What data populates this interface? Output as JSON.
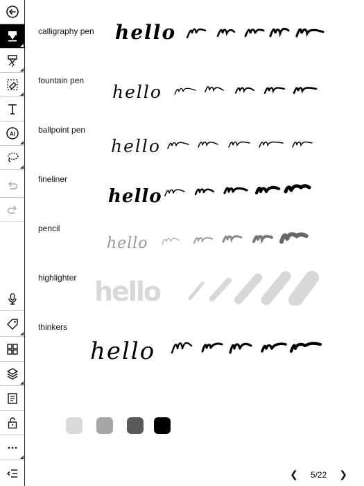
{
  "toolbar": {
    "items": [
      {
        "name": "back-icon"
      },
      {
        "name": "calligraphy-pen-tool-icon",
        "active": true
      },
      {
        "name": "eraser-pen-icon"
      },
      {
        "name": "eraser-icon"
      },
      {
        "name": "text-tool-icon",
        "glyph": "T"
      },
      {
        "name": "ai-tool-icon",
        "glyph": "AI"
      },
      {
        "name": "lasso-icon"
      },
      {
        "name": "undo-icon"
      },
      {
        "name": "redo-icon"
      },
      {
        "name": "microphone-icon"
      },
      {
        "name": "tag-icon"
      },
      {
        "name": "grid-icon"
      },
      {
        "name": "layers-icon"
      },
      {
        "name": "document-icon"
      },
      {
        "name": "lock-icon"
      },
      {
        "name": "more-icon",
        "glyph": "···"
      },
      {
        "name": "collapse-menu-icon"
      }
    ]
  },
  "pens": [
    {
      "label": "calligraphy pen"
    },
    {
      "label": "fountain pen"
    },
    {
      "label": "ballpoint pen"
    },
    {
      "label": "fineliner"
    },
    {
      "label": "pencil"
    },
    {
      "label": "highlighter"
    },
    {
      "label": "thinkers"
    }
  ],
  "sample_word": "hello",
  "colors": {
    "swatches": [
      "#d9d9d9",
      "#a6a6a6",
      "#595959",
      "#000000"
    ],
    "ink": "#000000",
    "highlighter": "#d8d8d8",
    "pencil": "#888888"
  },
  "pager": {
    "page": "5/22",
    "prev_icon": "chevron-left-icon",
    "next_icon": "chevron-right-icon"
  }
}
